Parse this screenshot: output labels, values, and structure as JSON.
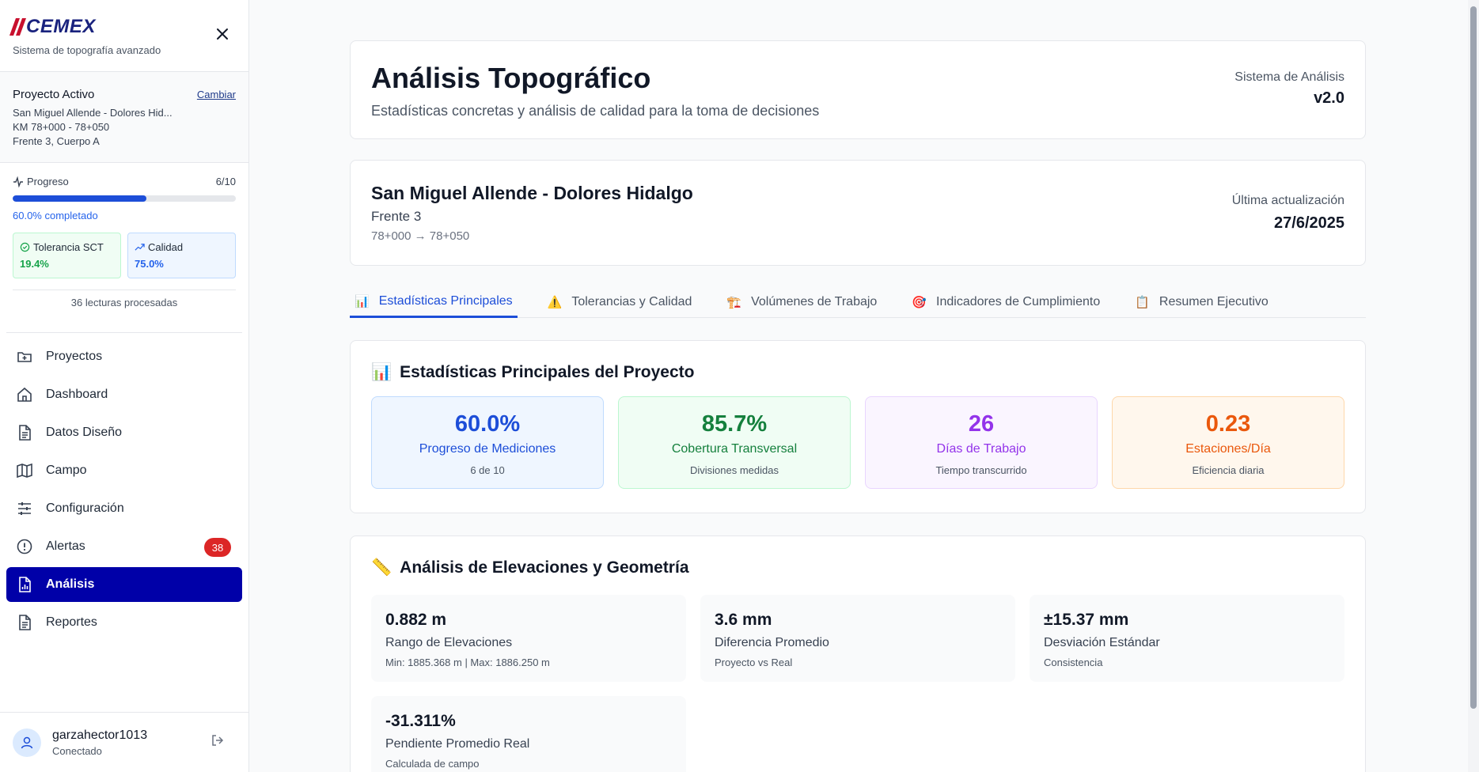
{
  "brand": {
    "logo_text": "CEMEX",
    "subtitle": "Sistema de topografía avanzado"
  },
  "active_project": {
    "title": "Proyecto Activo",
    "change_link": "Cambiar",
    "name": "San Miguel Allende - Dolores Hid...",
    "km": "KM 78+000 - 78+050",
    "front": "Frente 3, Cuerpo A"
  },
  "progress": {
    "label": "Progreso",
    "count": "6/10",
    "fraction": 0.6,
    "completed_text": "60.0% completado",
    "tolerance_label": "Tolerancia SCT",
    "tolerance_value": "19.4%",
    "quality_label": "Calidad",
    "quality_value": "75.0%",
    "readings": "36 lecturas procesadas"
  },
  "nav": {
    "items": [
      {
        "label": "Proyectos",
        "icon": "folder-plus-icon"
      },
      {
        "label": "Dashboard",
        "icon": "home-icon"
      },
      {
        "label": "Datos Diseño",
        "icon": "document-icon"
      },
      {
        "label": "Campo",
        "icon": "map-icon"
      },
      {
        "label": "Configuración",
        "icon": "sliders-icon"
      },
      {
        "label": "Alertas",
        "icon": "alert-circle-icon",
        "badge": "38"
      },
      {
        "label": "Análisis",
        "icon": "chart-file-icon",
        "active": true
      },
      {
        "label": "Reportes",
        "icon": "document-icon"
      }
    ]
  },
  "user": {
    "name": "garzahector1013",
    "status": "Conectado"
  },
  "header": {
    "title": "Análisis Topográfico",
    "subtitle": "Estadísticas concretas y análisis de calidad para la toma de decisiones",
    "system_label": "Sistema de Análisis",
    "version": "v2.0"
  },
  "project_card": {
    "name": "San Miguel Allende - Dolores Hidalgo",
    "front": "Frente 3",
    "range": "78+000 → 78+050",
    "updated_label": "Última actualización",
    "updated_date": "27/6/2025"
  },
  "tabs": [
    {
      "label": "Estadísticas Principales",
      "icon": "📊",
      "active": true
    },
    {
      "label": "Tolerancias y Calidad",
      "icon": "⚠️"
    },
    {
      "label": "Volúmenes de Trabajo",
      "icon": "🏗️"
    },
    {
      "label": "Indicadores de Cumplimiento",
      "icon": "🎯"
    },
    {
      "label": "Resumen Ejecutivo",
      "icon": "📋"
    }
  ],
  "stats": {
    "title": "Estadísticas Principales del Proyecto",
    "icon": "📊",
    "cards": [
      {
        "value": "60.0%",
        "label": "Progreso de Mediciones",
        "sub": "6 de 10",
        "color": "blue"
      },
      {
        "value": "85.7%",
        "label": "Cobertura Transversal",
        "sub": "Divisiones medidas",
        "color": "green"
      },
      {
        "value": "26",
        "label": "Días de Trabajo",
        "sub": "Tiempo transcurrido",
        "color": "purple"
      },
      {
        "value": "0.23",
        "label": "Estaciones/Día",
        "sub": "Eficiencia diaria",
        "color": "orange"
      }
    ]
  },
  "elevations": {
    "title": "Análisis de Elevaciones y Geometría",
    "icon": "📏",
    "cells": [
      {
        "value": "0.882 m",
        "label": "Rango de Elevaciones",
        "sub": "Min: 1885.368 m | Max: 1886.250 m"
      },
      {
        "value": "3.6 mm",
        "label": "Diferencia Promedio",
        "sub": "Proyecto vs Real"
      },
      {
        "value": "±15.37 mm",
        "label": "Desviación Estándar",
        "sub": "Consistencia"
      },
      {
        "value": "-31.311%",
        "label": "Pendiente Promedio Real",
        "sub": "Calculada de campo"
      }
    ]
  },
  "colors": {
    "accent": "#0000a8",
    "brand_red": "#c8102e",
    "brand_blue": "#1a237e",
    "alert": "#dc2626"
  }
}
